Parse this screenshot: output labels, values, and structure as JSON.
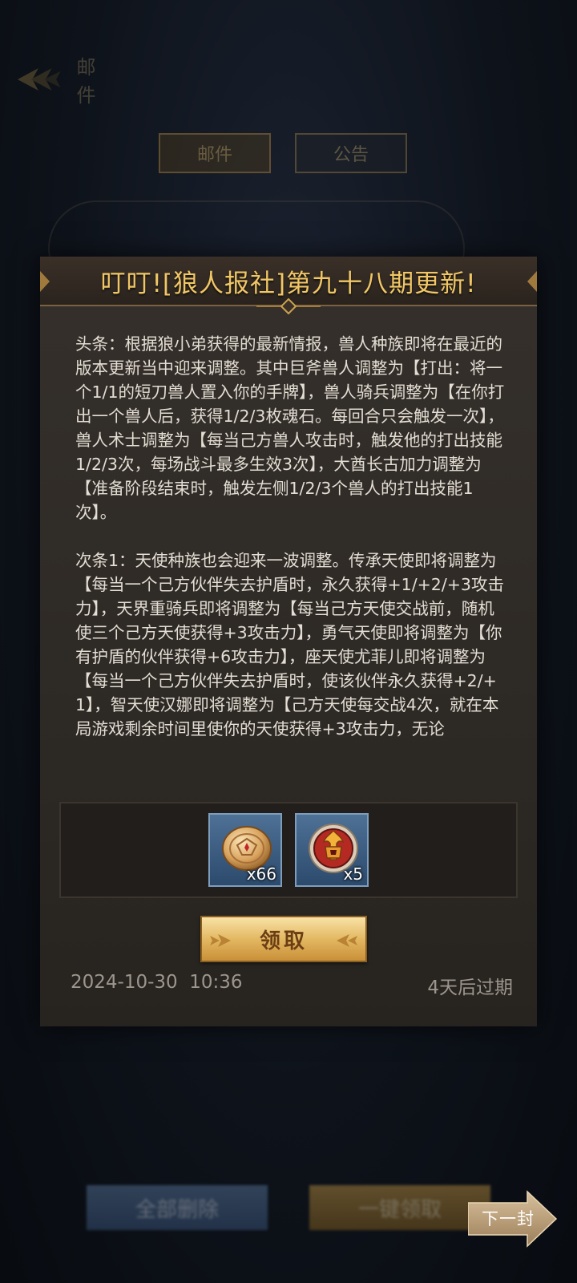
{
  "background": {
    "back_label": "邮件",
    "tabs": [
      "邮件",
      "公告"
    ],
    "bottom_buttons": [
      "全部删除",
      "一键领取"
    ],
    "next_label": "下一封"
  },
  "dialog": {
    "title": "叮叮![狼人报社]第九十八期更新!",
    "paragraphs": [
      "头条：根据狼小弟获得的最新情报，兽人种族即将在最近的版本更新当中迎来调整。其中巨斧兽人调整为【打出：将一个1/1的短刀兽人置入你的手牌】，兽人骑兵调整为【在你打出一个兽人后，获得1/2/3枚魂石。每回合只会触发一次】，兽人术士调整为【每当己方兽人攻击时，触发他的打出技能1/2/3次，每场战斗最多生效3次】，大酋长古加力调整为【准备阶段结束时，触发左侧1/2/3个兽人的打出技能1次】。",
      "次条1：天使种族也会迎来一波调整。传承天使即将调整为【每当一个己方伙伴失去护盾时，永久获得+1/+2/+3攻击力】，天界重骑兵即将调整为【每当己方天使交战前，随机使三个己方天使获得+3攻击力】，勇气天使即将调整为【你有护盾的伙伴获得+6攻击力】，座天使尤菲儿即将调整为【每当一个己方伙伴失去护盾时，使该伙伴永久获得+2/+1】，智天使汉娜即将调整为【己方天使每交战4次，就在本局游戏剩余时间里使你的天使获得+3攻击力，无论"
    ],
    "rewards": [
      {
        "icon": "gold-coin-icon",
        "qty": "x66"
      },
      {
        "icon": "helmet-badge-icon",
        "qty": "x5"
      }
    ],
    "claim_label": "领取",
    "date": "2024-10-30  10:36",
    "expire": "4天后过期"
  },
  "colors": {
    "title": "#f1c766",
    "claim_button": "#e3b862",
    "reward_tile": "#4e7196"
  }
}
